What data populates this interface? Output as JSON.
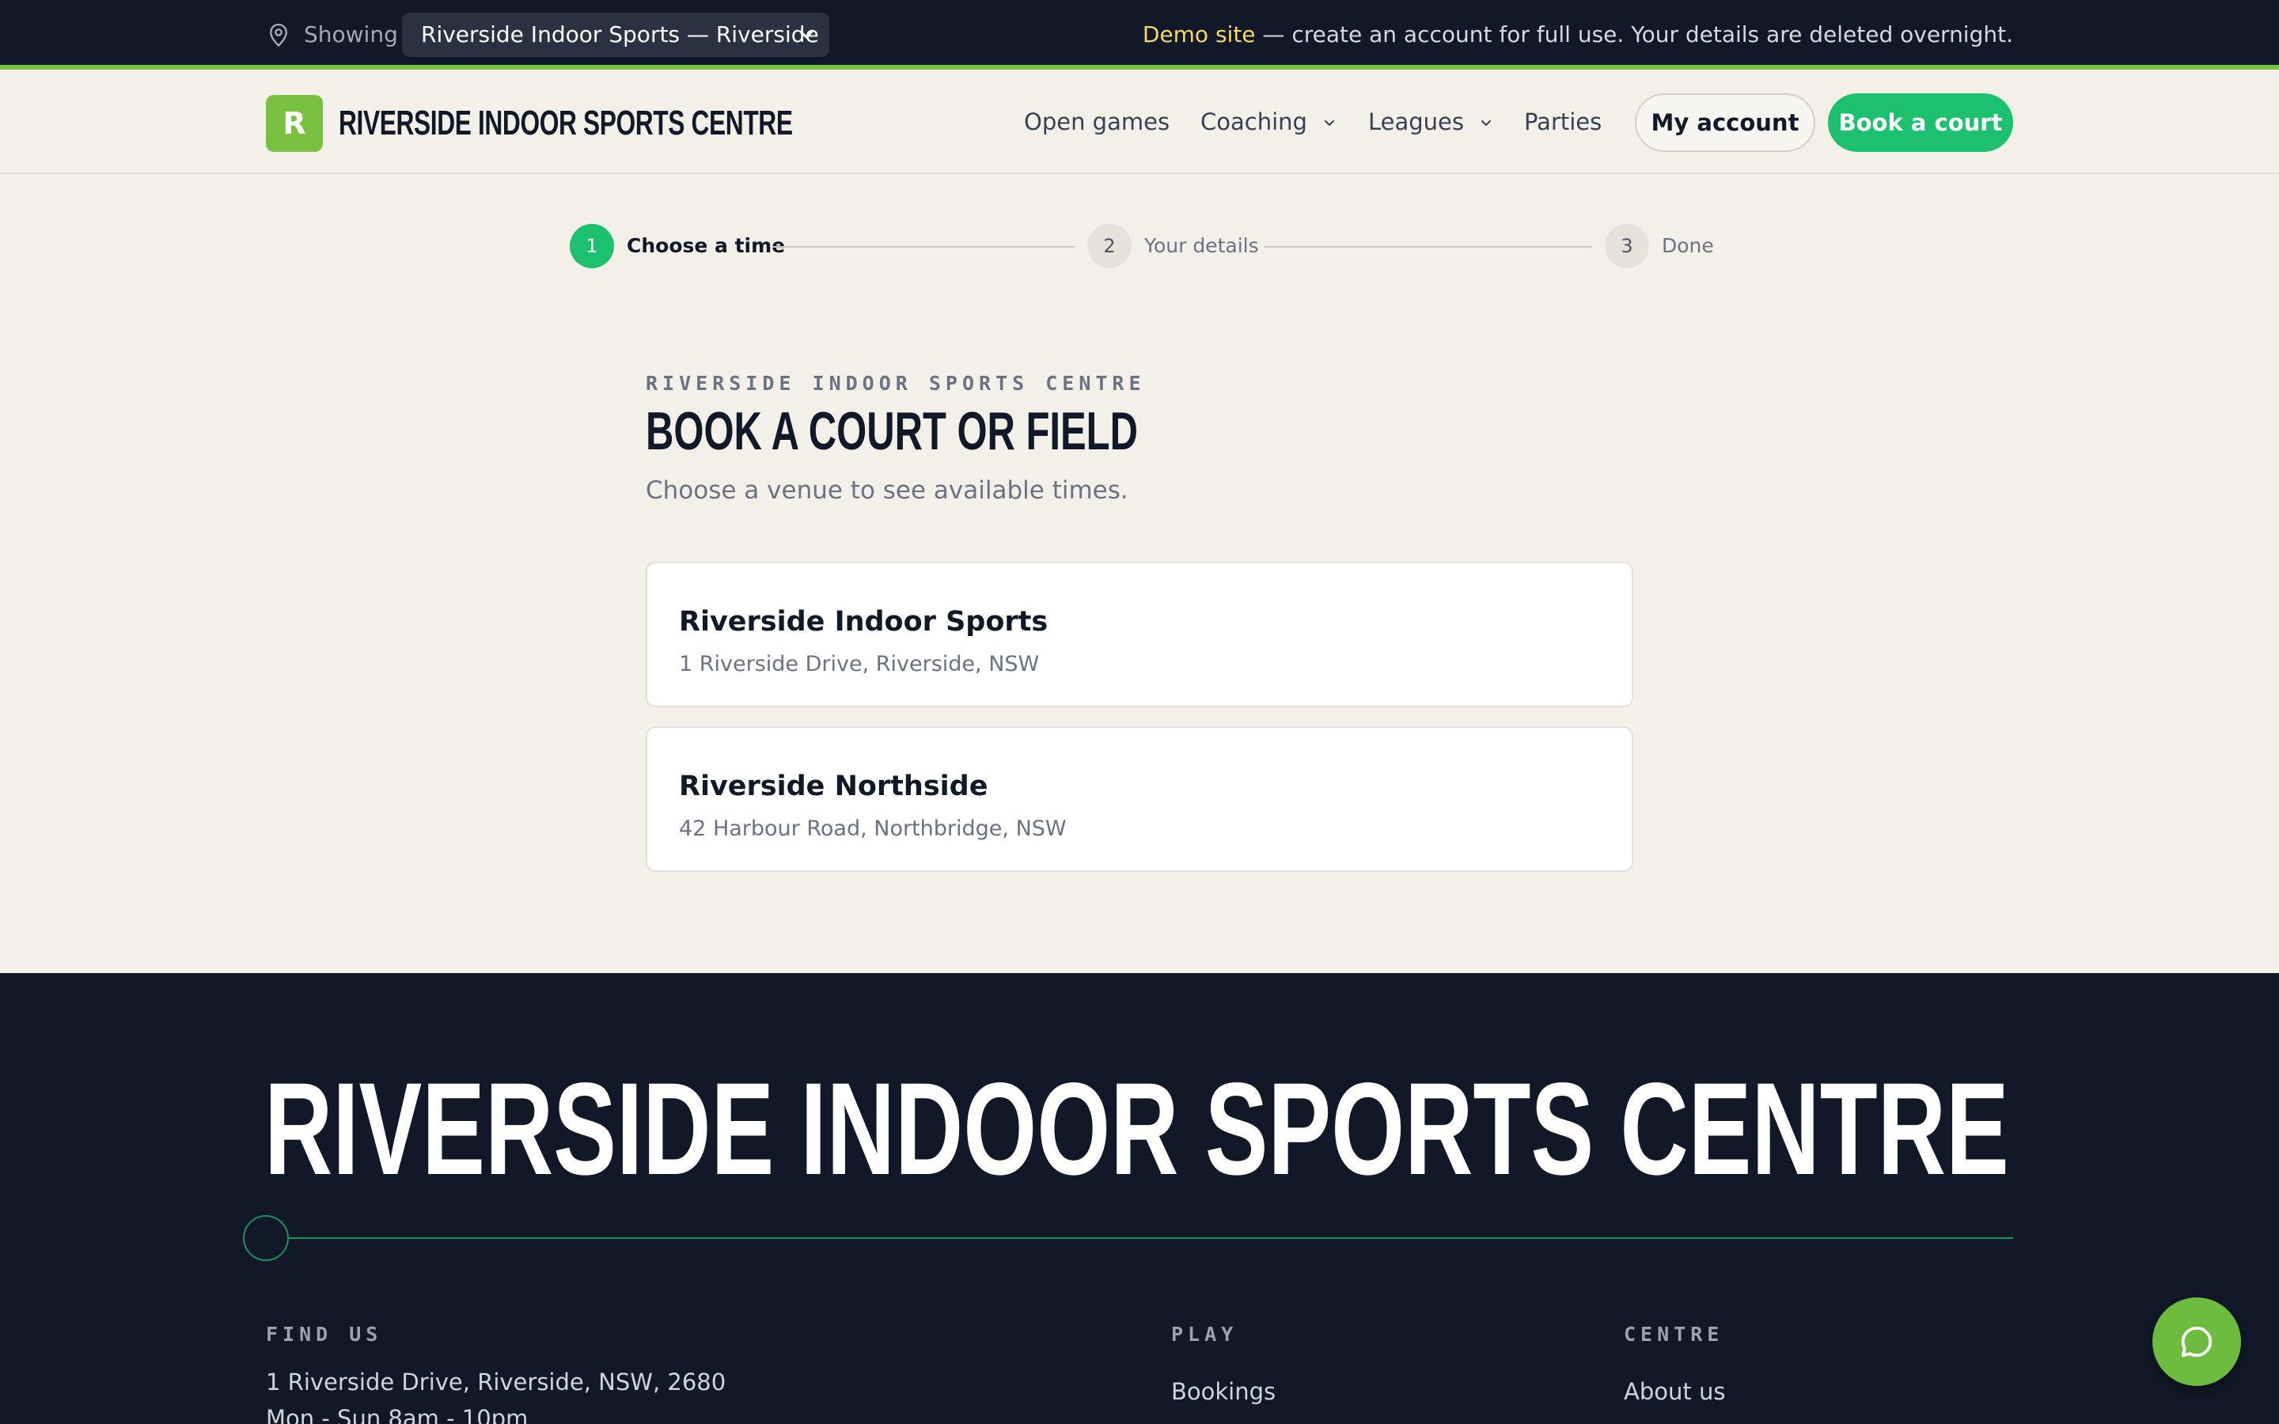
{
  "topbar": {
    "showing_label": "Showing",
    "venue_selected": "Riverside Indoor Sports — Riverside",
    "demo_highlight": "Demo site",
    "demo_text": " — create an account for full use. Your details are deleted overnight."
  },
  "header": {
    "logo_letter": "R",
    "logo_text": "RIVERSIDE INDOOR SPORTS CENTRE",
    "nav": {
      "open_games": "Open games",
      "coaching": "Coaching",
      "leagues": "Leagues",
      "parties": "Parties"
    },
    "my_account": "My account",
    "book_court": "Book a court"
  },
  "stepper": {
    "steps": [
      {
        "number": "1",
        "label": "Choose a time"
      },
      {
        "number": "2",
        "label": "Your details"
      },
      {
        "number": "3",
        "label": "Done"
      }
    ]
  },
  "main": {
    "eyebrow": "RIVERSIDE INDOOR SPORTS CENTRE",
    "title": "BOOK A COURT OR FIELD",
    "subtitle": "Choose a venue to see available times.",
    "venues": [
      {
        "name": "Riverside Indoor Sports",
        "address": "1 Riverside Drive, Riverside, NSW"
      },
      {
        "name": "Riverside Northside",
        "address": "42 Harbour Road, Northbridge, NSW"
      }
    ]
  },
  "footer": {
    "title": "RIVERSIDE INDOOR SPORTS CENTRE",
    "find_us": {
      "heading": "FIND US",
      "address": "1 Riverside Drive, Riverside, NSW, 2680",
      "hours": "Mon - Sun 8am - 10pm"
    },
    "play": {
      "heading": "PLAY",
      "first_link": "Bookings"
    },
    "centre": {
      "heading": "CENTRE",
      "first_link": "About us"
    }
  },
  "colors": {
    "accent_green": "#1cc06d",
    "brand_lime": "#7ac142",
    "navy": "#111827",
    "demo_yellow": "#f5d76e"
  }
}
